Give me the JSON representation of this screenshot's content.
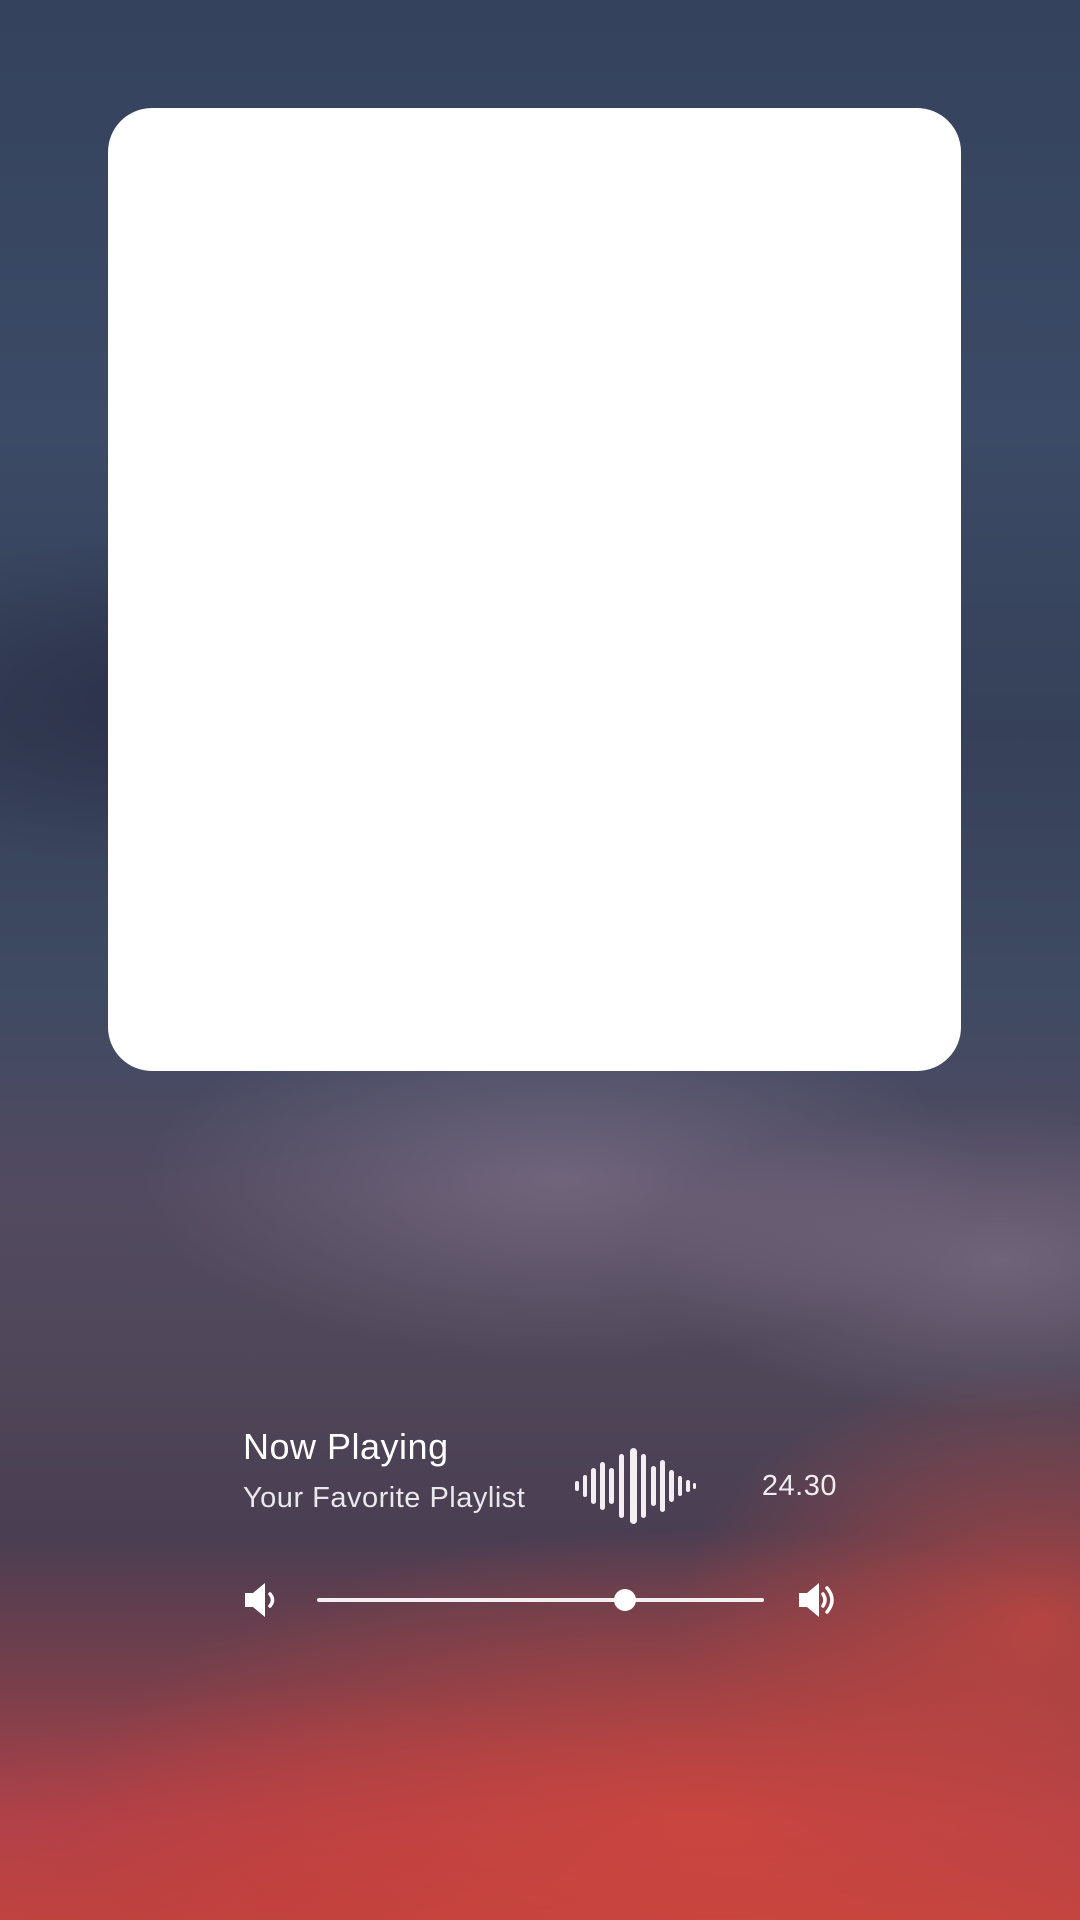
{
  "player": {
    "title": "Now Playing",
    "subtitle": "Your Favorite Playlist",
    "time": "24.30",
    "volume_fraction": 0.69
  },
  "icons": {
    "waveform": "waveform-icon",
    "volume_down": "volume-down-icon",
    "volume_up": "volume-up-icon"
  },
  "colors": {
    "card": "#ffffff",
    "text": "#ffffff"
  }
}
